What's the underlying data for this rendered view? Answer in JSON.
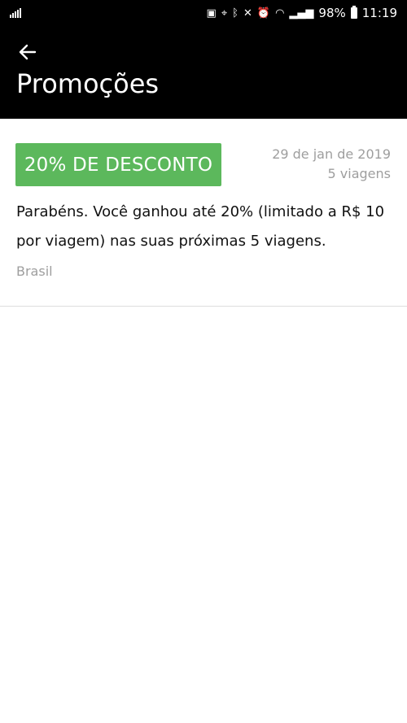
{
  "status_bar": {
    "battery": "98%",
    "time": "11:19",
    "icons": [
      "signal-icon",
      "notification-icon",
      "location-icon",
      "bluetooth-icon",
      "mute-icon",
      "alarm-icon",
      "wifi-icon",
      "cell-signal-icon",
      "battery-icon"
    ]
  },
  "app_bar": {
    "back_icon": "arrow-left-icon",
    "title": "Promoções"
  },
  "promo": {
    "badge": "20% DE DESCONTO",
    "date": "29 de jan de 2019",
    "trips": "5 viagens",
    "description": "Parabéns. Você ganhou até 20% (limitado a R$ 10 por viagem) nas suas próximas 5 viagens.",
    "region": "Brasil",
    "badge_color": "#5cb85c"
  }
}
